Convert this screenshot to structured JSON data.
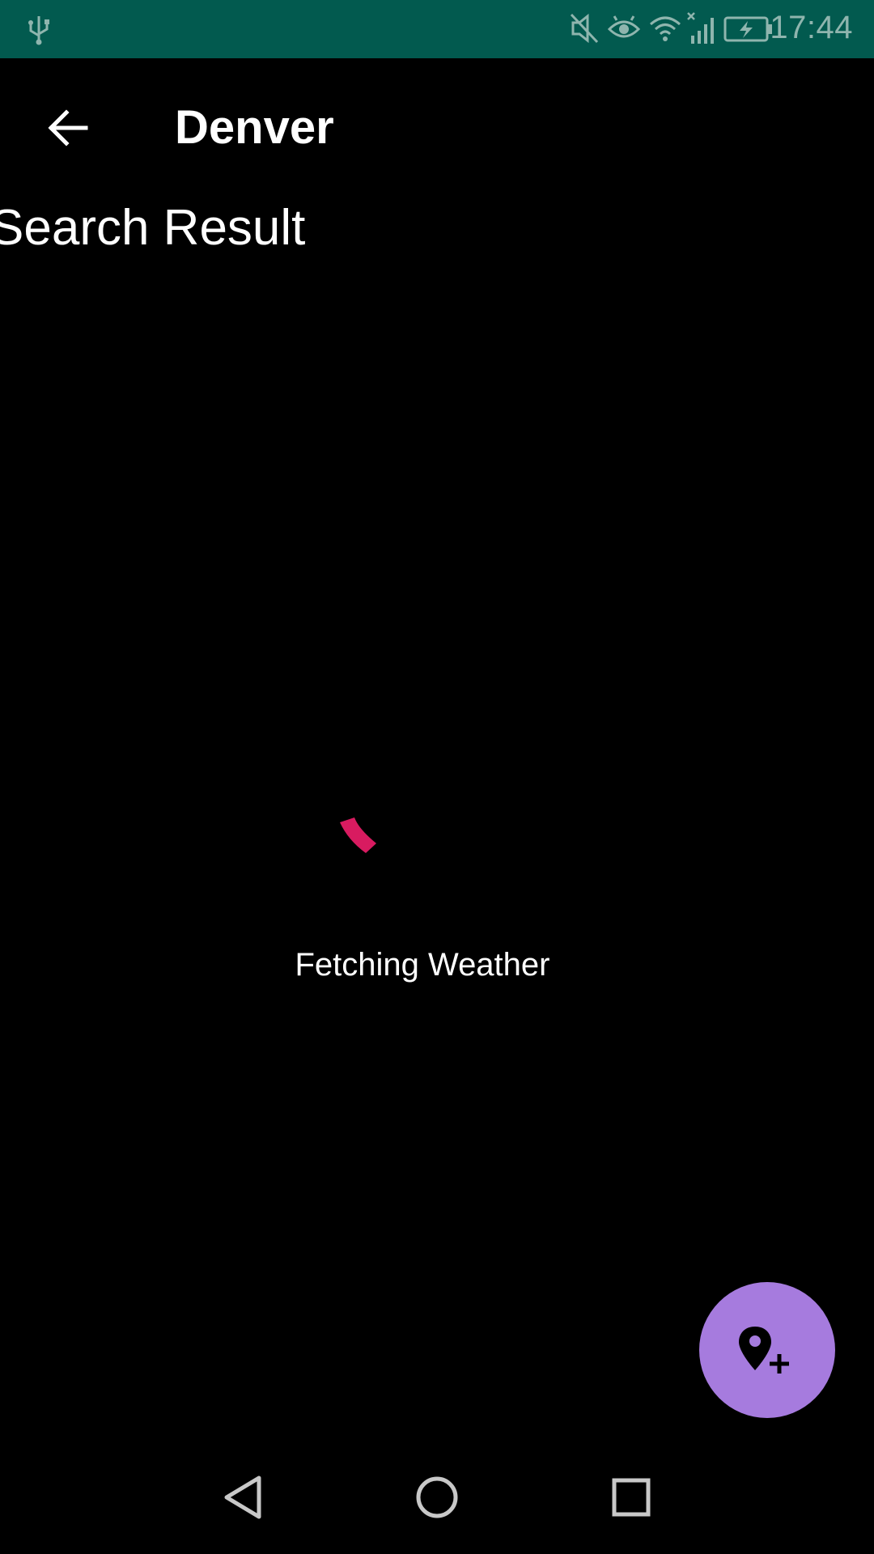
{
  "status_bar": {
    "time": "17:44",
    "icons": [
      "usb-icon",
      "mute-icon",
      "eye-comfort-icon",
      "wifi-icon",
      "no-signal-icon",
      "battery-charging-icon"
    ],
    "background": "#025a4f"
  },
  "app_bar": {
    "back_icon": "arrow-back-icon",
    "title": "Denver"
  },
  "content": {
    "section_title": "Search Result",
    "loading_text": "Fetching Weather",
    "spinner_color": "#d81b60"
  },
  "fab": {
    "icon": "add-location-icon",
    "color": "#a67bde"
  },
  "nav_bar": {
    "buttons": [
      "back-triangle-icon",
      "home-circle-icon",
      "recents-square-icon"
    ]
  }
}
